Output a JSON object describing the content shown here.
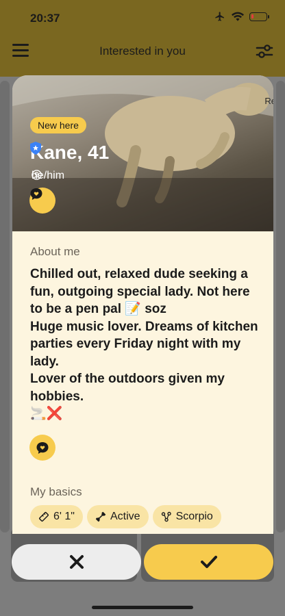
{
  "status_bar": {
    "time": "20:37",
    "icons": [
      "airplane-icon",
      "wifi-icon",
      "battery-low-icon"
    ]
  },
  "nav": {
    "title": "Interested in you",
    "menu_icon": "menu-icon",
    "filter_icon": "filter-icon"
  },
  "profile": {
    "photo_overlay_text": "Re",
    "badge": "New here",
    "name": "Kane, 41",
    "verified_icon": "verified-shield-icon",
    "pronouns": "he/him",
    "about_label": "About me",
    "about_text": "Chilled out, relaxed dude seeking a fun, outgoing special lady. Not here to be a pen pal 📝 soz\nHuge music lover. Dreams of kitchen parties every Friday night with my lady.\nLover of the outdoors given my hobbies.\n🚬❌",
    "basics_label": "My basics",
    "basics": [
      {
        "icon": "ruler-icon",
        "label": "6' 1\""
      },
      {
        "icon": "dumbbell-icon",
        "label": "Active"
      },
      {
        "icon": "zodiac-icon",
        "label": "Scorpio"
      }
    ]
  },
  "actions": {
    "pass_icon": "close-icon",
    "like_icon": "check-icon"
  },
  "colors": {
    "accent": "#f7cb4d",
    "sheet_bg": "#fdf5df",
    "chip_bg": "#f9e4a5",
    "verified": "#3b82f6"
  }
}
